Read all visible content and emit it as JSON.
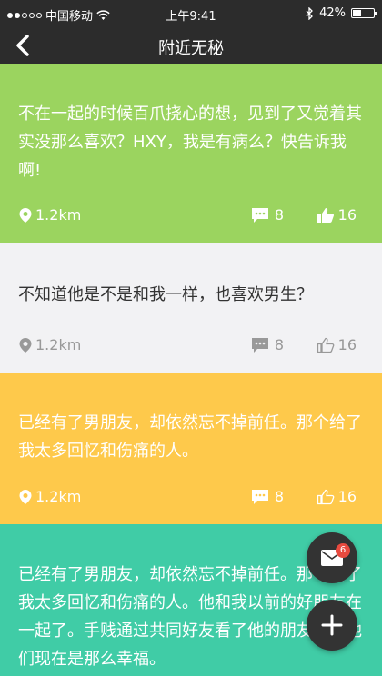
{
  "status_bar": {
    "carrier": "中国移动",
    "time": "上午9:41",
    "battery_text": "42%",
    "battery_level": 0.42,
    "signal_dots_full": 2,
    "signal_dots_total": 5,
    "icons": [
      "wifi-icon",
      "bluetooth-icon",
      "battery-icon"
    ]
  },
  "nav": {
    "title": "附近无秘",
    "back_icon": "back-arrow-icon"
  },
  "posts": [
    {
      "text": "不在一起的时候百爪挠心的想，见到了又觉着其实没那么喜欢？HXY，我是有病么？快告诉我啊!",
      "distance": "1.2km",
      "comments": "8",
      "likes": "16",
      "liked": true,
      "bg_color": "#9bd45f"
    },
    {
      "text": "不知道他是不是和我一样，也喜欢男生？",
      "distance": "1.2km",
      "comments": "8",
      "likes": "16",
      "liked": false,
      "bg_color": "#f2f2f4"
    },
    {
      "text": "已经有了男朋友，却依然忘不掉前任。那个给了我太多回忆和伤痛的人。",
      "distance": "1.2km",
      "comments": "8",
      "likes": "16",
      "liked": false,
      "bg_color": "#fec94b"
    },
    {
      "text": "已经有了男朋友，却依然忘不掉前任。那个给了我太多回忆和伤痛的人。他和我以前的好朋友在一起了。手贱通过共同好友看了他的朋友圈，他们现在是那么幸福。",
      "bg_color": "#40cca6"
    }
  ],
  "fab": {
    "mail_badge": "6",
    "mail_icon": "mail-icon",
    "add_icon": "plus-icon"
  }
}
